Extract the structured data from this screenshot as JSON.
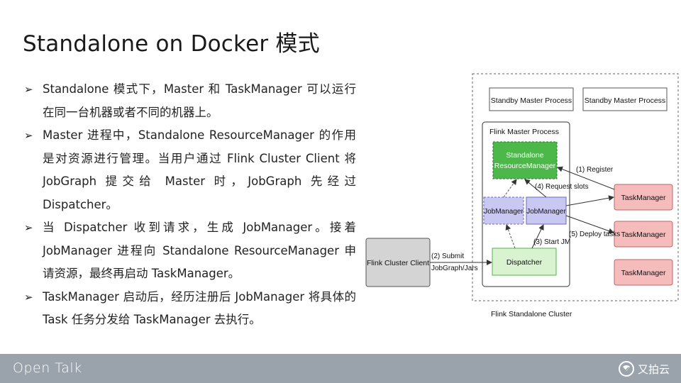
{
  "slide": {
    "title": "Standalone on Docker 模式",
    "bullet_marker": "➢",
    "bullets": [
      "Standalone 模式下，Master 和 TaskManager 可以运行在同一台机器或者不同的机器上。",
      "Master 进程中，Standalone ResourceManager 的作用是对资源进行管理。当用户通过 Flink Cluster Client 将 JobGraph 提交给 Master 时，JobGraph 先经过 Dispatcher。",
      "当 Dispatcher 收到请求，生成 JobManager。接着 JobManager 进程向 Standalone ResourceManager 申请资源，最终再启动 TaskManager。",
      "TaskManager 启动后，经历注册后 JobManager 将具体的 Task 任务分发给 TaskManager 去执行。"
    ]
  },
  "diagram": {
    "standby_1": "Standby Master Process",
    "standby_2": "Standby Master Process",
    "master_process": "Flink Master Process",
    "resource_manager_line1": "Standalone",
    "resource_manager_line2": "ResourceManager",
    "jobmanager_a": "JobManager",
    "jobmanager_b": "JobManager",
    "dispatcher": "Dispatcher",
    "client": "Flink Cluster Client",
    "taskmanager_1": "TaskManager",
    "taskmanager_2": "TaskManager",
    "taskmanager_3": "TaskManager",
    "edge_register": "(1) Register",
    "edge_request_slots": "(4) Request slots",
    "edge_deploy_tasks": "(5) Deploy tasks",
    "edge_start_jm": "(3) Start JM",
    "edge_submit_line1": "(2) Submit",
    "edge_submit_line2": "JobGraph/Jars",
    "cluster_label": "Flink Standalone Cluster",
    "colors": {
      "green_fill": "#4db84a",
      "green_light": "#d9f2d0",
      "purple_fill": "#c9c8f3",
      "pink_fill": "#f6bcbc",
      "gray_fill": "#d4d4d4"
    }
  },
  "footer": {
    "left": "Open Talk",
    "right": "又拍云"
  }
}
